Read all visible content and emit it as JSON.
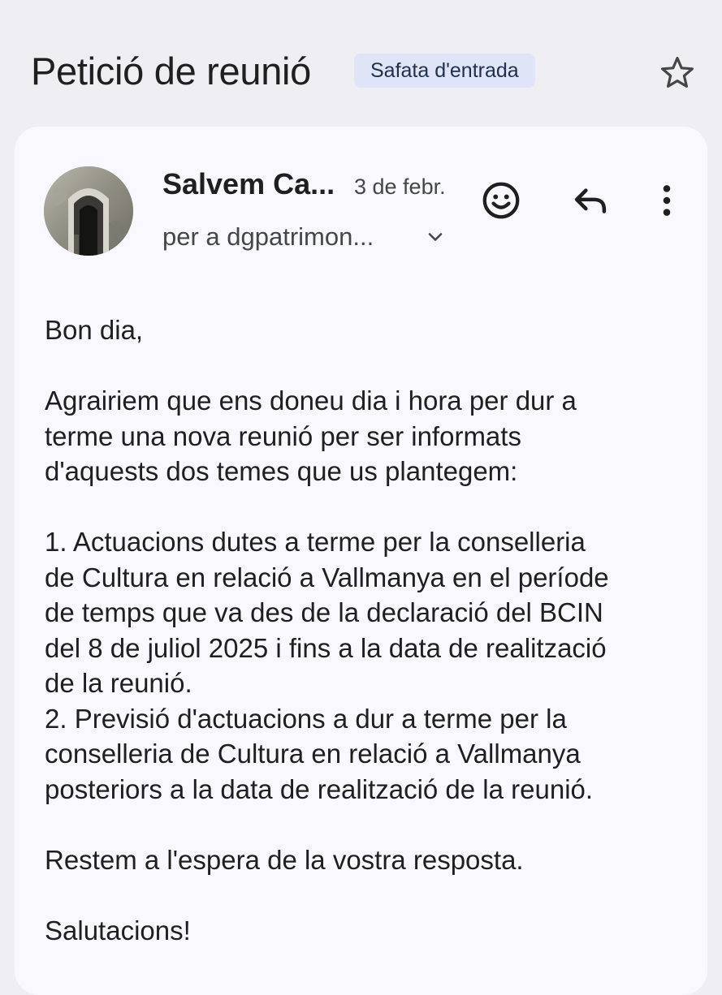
{
  "header": {
    "subject": "Petició de reunió",
    "label": "Safata d'entrada",
    "star_icon": "star-outline-icon"
  },
  "message": {
    "sender": "Salvem Ca...",
    "date": "3 de febr.",
    "recipient": "per a dgpatrimon...",
    "actions": {
      "emoji_icon": "smiley-face-icon",
      "reply_icon": "reply-arrow-icon",
      "more_icon": "vertical-dots-icon",
      "expand_icon": "chevron-down-icon"
    },
    "body": {
      "greeting": "Bon dia,",
      "para1_line1": "Agrairiem que ens doneu dia i hora per dur a",
      "para1_line2": "terme una nova reunió per ser informats",
      "para1_line3": "d'aquests dos temes que us plantegem:",
      "item1_line1": "1. Actuacions dutes a terme per la conselleria",
      "item1_line2": "de Cultura en relació a Vallmanya en el període",
      "item1_line3": "de temps que va des de la declaració del BCIN",
      "item1_line4": "del 8 de juliol 2025 i fins a la data de realització",
      "item1_line5": "de la reunió.",
      "item2_line1": "2. Previsió d'actuacions a dur a terme per la",
      "item2_line2": "conselleria de Cultura en relació a Vallmanya",
      "item2_line3": "posteriors a la data de realització de la reunió.",
      "closing": "Restem a l'espera de la vostra resposta.",
      "signoff": "Salutacions!"
    }
  },
  "colors": {
    "page_bg": "#eeeef3",
    "card_bg": "#f8f8fe",
    "chip_bg": "#dfe4f7",
    "text": "#1f1f1f",
    "muted": "#444746"
  }
}
